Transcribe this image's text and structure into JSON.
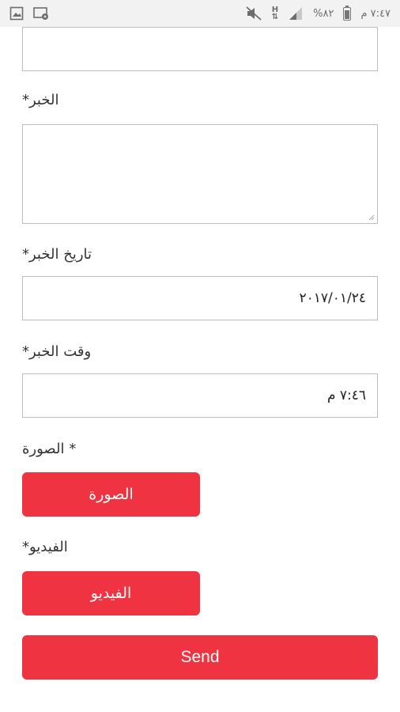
{
  "statusbar": {
    "time": "٧:٤٧ م",
    "battery": "%٨٢",
    "battery_level": 0.82,
    "network_letter": "H",
    "icons": [
      "battery-icon",
      "signal-icon",
      "data-arrows-icon",
      "mute-icon",
      "screen-cast-icon",
      "gallery-icon"
    ]
  },
  "form": {
    "news_label": "الخبر*",
    "news_date_label": "تاريخ الخبر*",
    "news_date_value": "٢٠١٧/٠١/٢٤",
    "news_time_label": "وقت الخبر*",
    "news_time_value": "٧:٤٦ م",
    "image_label": "* الصورة",
    "image_button": "الصورة",
    "video_label": "الفيديو*",
    "video_button": "الفيديو",
    "send_button": "Send"
  },
  "colors": {
    "accent": "#ef3341",
    "statusbar_bg": "#f2f2f2",
    "border": "#bdbdbd"
  }
}
